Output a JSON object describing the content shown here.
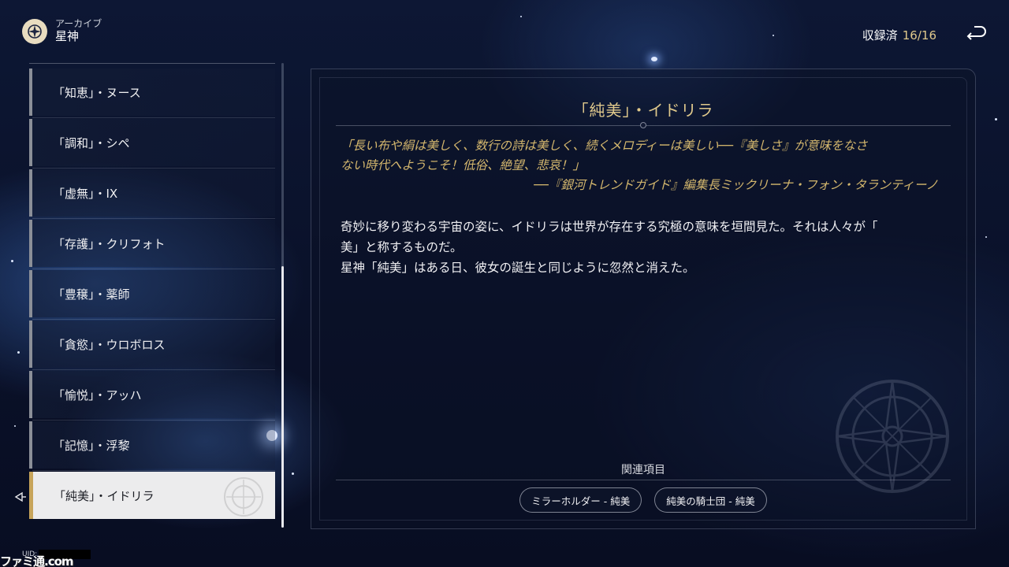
{
  "header": {
    "icon": "archive-star-icon",
    "subtitle": "アーカイブ",
    "title": "星神",
    "collected_label": "収録済",
    "collected_count": "16/16",
    "back_icon": "back-arrow-icon"
  },
  "list": {
    "items": [
      {
        "label": "「知恵」・ヌース"
      },
      {
        "label": "「調和」・シペ"
      },
      {
        "label": "「虚無」・IX"
      },
      {
        "label": "「存護」・クリフォト"
      },
      {
        "label": "「豊穣」・薬師"
      },
      {
        "label": "「貪慾」・ウロボロス"
      },
      {
        "label": "「愉悦」・アッハ"
      },
      {
        "label": "「記憶」・浮黎"
      },
      {
        "label": "「純美」・イドリラ"
      }
    ],
    "selected_index": 8,
    "scroll_fraction": 0.56
  },
  "content": {
    "title": "「純美」・イドリラ",
    "quote_line1": "「長い布や絹は美しく、数行の詩は美しく、続くメロディーは美しい──『美しさ』が意味をなさ",
    "quote_line2": "ない時代へようこそ！低俗、絶望、悲哀！」",
    "quote_source": "──『銀河トレンドガイド』編集長ミックリーナ・フォン・タランティーノ",
    "body_line1": "奇妙に移り変わる宇宙の姿に、イドリラは世界が存在する究極の意味を垣間見た。それは人々が「",
    "body_line2": "美」と称するものだ。",
    "body_line3": "星神「純美」はある日、彼女の誕生と同じように忽然と消えた。",
    "related_label": "関連項目",
    "related": [
      {
        "label": "ミラーホルダー - 純美"
      },
      {
        "label": "純美の騎士団 - 純美"
      }
    ]
  },
  "footer": {
    "uid_label": "UID:",
    "watermark": "ファミ通.com"
  },
  "colors": {
    "gold": "#d3b66d",
    "title_gold": "#e0c98c",
    "selected_bg": "#ececed",
    "selected_bar": "#c7a45a"
  }
}
